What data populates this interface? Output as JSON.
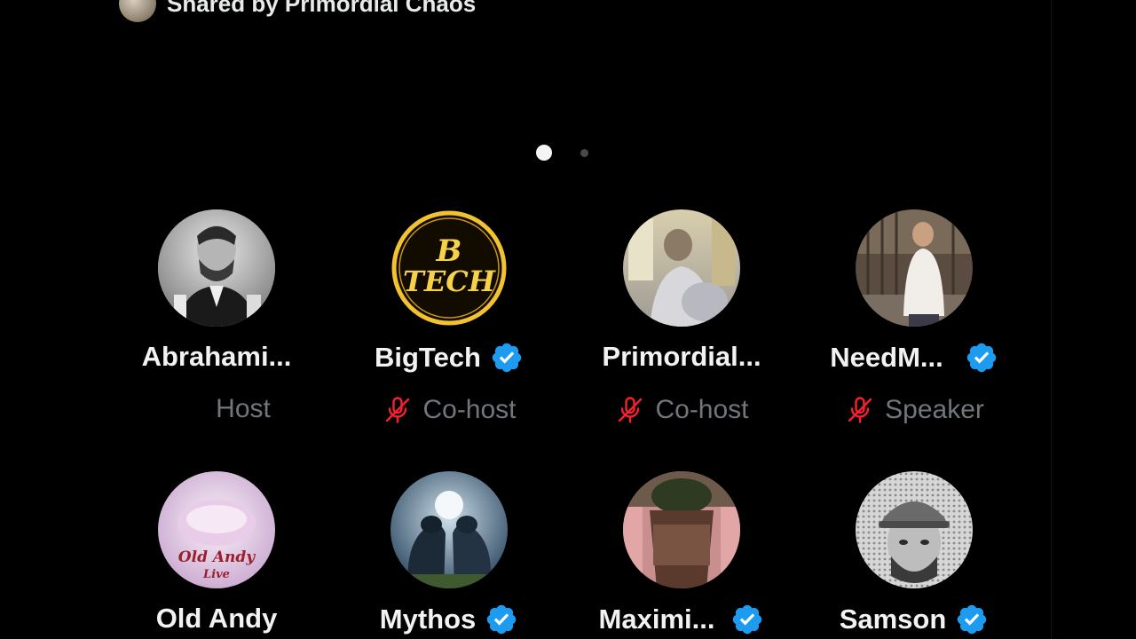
{
  "shared_by": {
    "text": "Shared by Primordial Chaos"
  },
  "pagination": {
    "pages": 2,
    "active_index": 0
  },
  "colors": {
    "background": "#000000",
    "name_text": "#f2f2f2",
    "role_text": "#71767b",
    "verified_badge": "#1d9bf0",
    "muted_mic": "#f4212e"
  },
  "participants": [
    {
      "name": "Abrahami...",
      "role": "Host",
      "verified": false,
      "muted": false,
      "avatar": "lincoln-portrait"
    },
    {
      "name": "BigTech",
      "role": "Co-host",
      "verified": true,
      "muted": true,
      "avatar": "bigtech-logo",
      "avatar_text": "BIG TECH"
    },
    {
      "name": "Primordial...",
      "role": "Co-host",
      "verified": false,
      "muted": true,
      "avatar": "kitchen-photo"
    },
    {
      "name": "NeedM...",
      "role": "Speaker",
      "verified": true,
      "muted": true,
      "avatar": "man-in-room-photo"
    },
    {
      "name": "Old Andy",
      "role": "",
      "verified": false,
      "muted": false,
      "avatar": "old-andy-logo",
      "avatar_text": "Old Andy Live"
    },
    {
      "name": "Mythos",
      "role": "",
      "verified": true,
      "muted": false,
      "avatar": "bears-fighting-art"
    },
    {
      "name": "Maximi...",
      "role": "",
      "verified": true,
      "muted": false,
      "avatar": "planter-photo"
    },
    {
      "name": "Samson",
      "role": "",
      "verified": true,
      "muted": false,
      "avatar": "man-in-cap-photo"
    }
  ]
}
